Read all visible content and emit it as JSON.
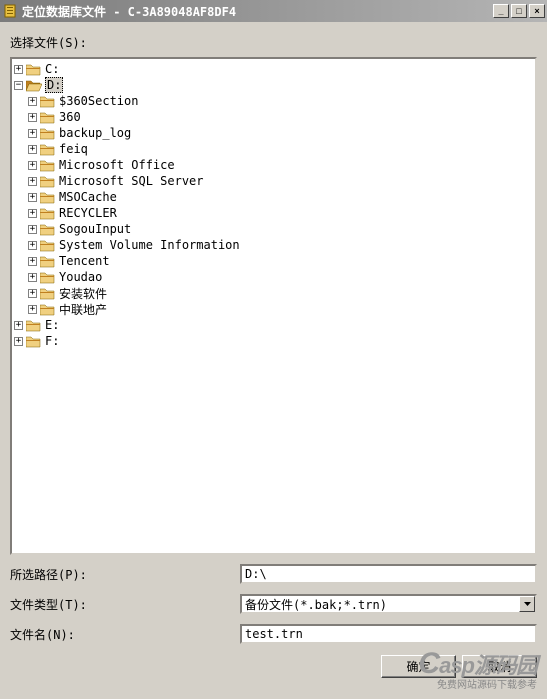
{
  "titlebar": {
    "title": "定位数据库文件 - C-3A89048AF8DF4"
  },
  "labels": {
    "select_file": "选择文件(S):",
    "selected_path": "所选路径(P):",
    "file_type": "文件类型(T):",
    "file_name": "文件名(N):"
  },
  "tree": {
    "drives": [
      {
        "label": "C:",
        "expanded": false,
        "children": []
      },
      {
        "label": "D:",
        "expanded": true,
        "selected": true,
        "children": [
          {
            "label": "$360Section"
          },
          {
            "label": "360"
          },
          {
            "label": "backup_log"
          },
          {
            "label": "feiq"
          },
          {
            "label": "Microsoft Office"
          },
          {
            "label": "Microsoft SQL Server"
          },
          {
            "label": "MSOCache"
          },
          {
            "label": "RECYCLER"
          },
          {
            "label": "SogouInput"
          },
          {
            "label": "System Volume Information"
          },
          {
            "label": "Tencent"
          },
          {
            "label": "Youdao"
          },
          {
            "label": "安装软件"
          },
          {
            "label": "中联地产"
          }
        ]
      },
      {
        "label": "E:",
        "expanded": false,
        "children": []
      },
      {
        "label": "F:",
        "expanded": false,
        "children": []
      }
    ]
  },
  "fields": {
    "path_value": "D:\\",
    "type_value": "备份文件(*.bak;*.trn)",
    "filename_value": "test.trn"
  },
  "buttons": {
    "ok": "确定",
    "cancel": "取消"
  },
  "watermark": {
    "brand": "Casp源码园",
    "subtitle": "免费网站源码下载参考"
  }
}
